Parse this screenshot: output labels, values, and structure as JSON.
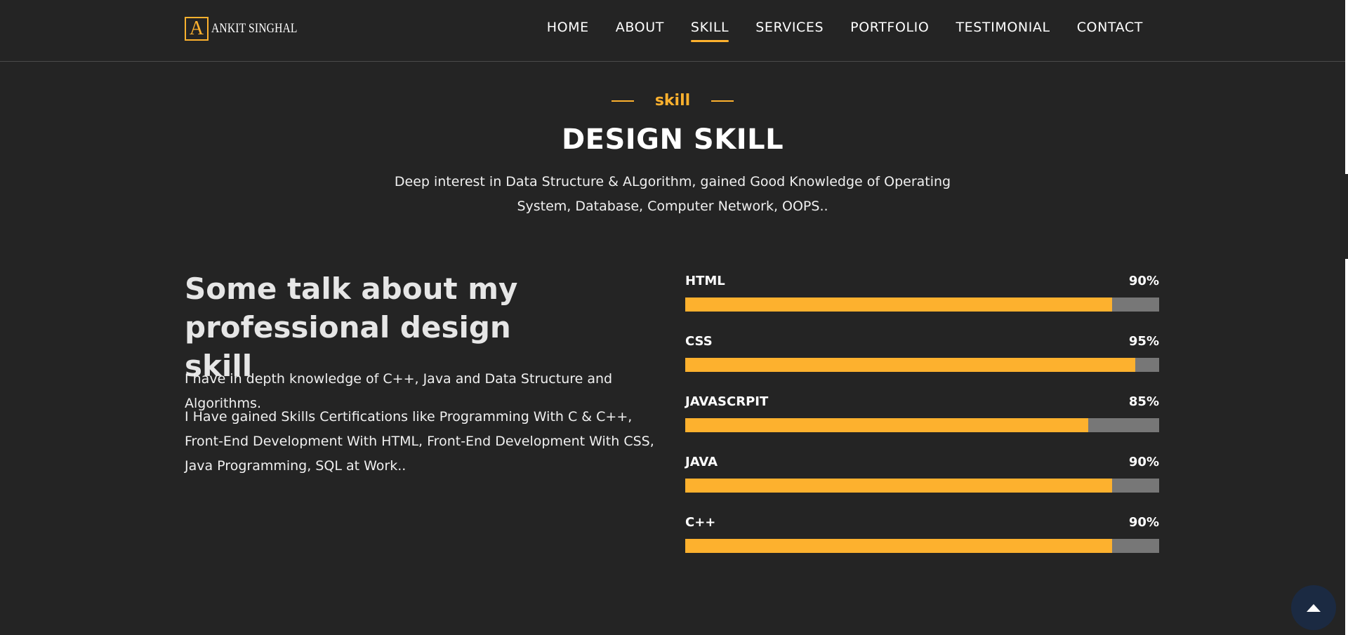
{
  "brand": {
    "mark": "A",
    "name": "ANKIT SINGHAL"
  },
  "nav": [
    {
      "label": "HOME"
    },
    {
      "label": "ABOUT"
    },
    {
      "label": "SKILL",
      "active": true
    },
    {
      "label": "SERVICES"
    },
    {
      "label": "PORTFOLIO"
    },
    {
      "label": "TESTIMONIAL"
    },
    {
      "label": "CONTACT"
    }
  ],
  "section": {
    "tag": "skill",
    "title": "DESIGN SKILL",
    "description": "Deep interest in Data Structure & ALgorithm, gained Good Knowledge of Operating System, Database, Computer Network, OOPS.."
  },
  "about": {
    "title": "Some talk about my professional design skill",
    "p1": "I have in depth knowledge of C++, Java and Data Structure and Algorithms.",
    "p2": "I Have gained Skills Certifications like Programming With C & C++, Front-End Development With HTML, Front-End Development With CSS, Java Programming, SQL at Work.."
  },
  "skills": [
    {
      "name": "HTML",
      "percent_label": "90%",
      "level": 0.9
    },
    {
      "name": "CSS",
      "percent_label": "95%",
      "level": 0.95
    },
    {
      "name": "JAVASCRPIT",
      "percent_label": "85%",
      "level": 0.85
    },
    {
      "name": "JAVA",
      "percent_label": "90%",
      "level": 0.9
    },
    {
      "name": "C++",
      "percent_label": "90%",
      "level": 0.9
    }
  ],
  "colors": {
    "accent": "#fdb12e",
    "background": "#242424",
    "track": "#777777",
    "to_top_bg": "#1b2a42"
  },
  "icons": {
    "back_to_top": "arrow-up-icon"
  }
}
